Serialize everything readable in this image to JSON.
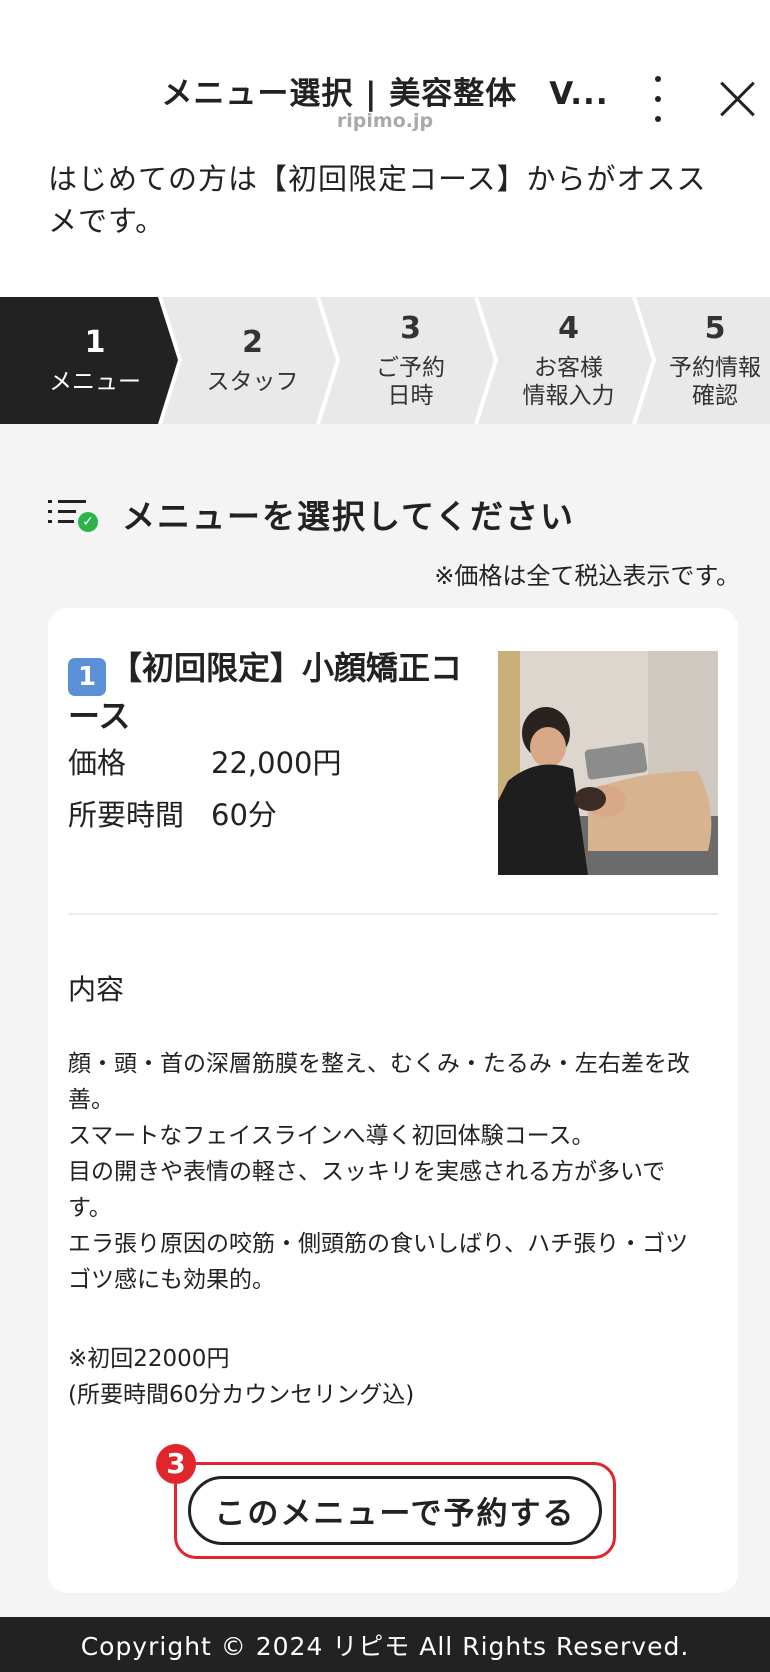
{
  "header": {
    "title": "メニュー選択 | 美容整体　V...",
    "domain": "ripimo.jp"
  },
  "intro": "はじめての方は【初回限定コース】からがオススメです。",
  "steps": [
    {
      "num": "1",
      "label": "メニュー",
      "active": true
    },
    {
      "num": "2",
      "label": "スタッフ",
      "active": false
    },
    {
      "num": "3",
      "label": "ご予約\n日時",
      "active": false
    },
    {
      "num": "4",
      "label": "お客様\n情報入力",
      "active": false
    },
    {
      "num": "5",
      "label": "予約情報\n確認",
      "active": false
    }
  ],
  "section": {
    "title": "メニューを選択してください",
    "price_note": "※価格は全て税込表示です。"
  },
  "course": {
    "badge": "1",
    "title": "【初回限定】小顔矯正コース",
    "price_label": "価格",
    "price_value": "22,000円",
    "duration_label": "所要時間",
    "duration_value": "60分",
    "content_heading": "内容",
    "description": "顔・頭・首の深層筋膜を整え、むくみ・たるみ・左右差を改善。\nスマートなフェイスラインへ導く初回体験コース。\n目の開きや表情の軽さ、スッキリを実感される方が多いです。\nエラ張り原因の咬筋・側頭筋の食いしばり、ハチ張り・ゴツゴツ感にも効果的。",
    "note_line1": "※初回22000円",
    "note_line2": "(所要時間60分カウンセリング込)",
    "cta": "このメニューで予約する"
  },
  "annotation": {
    "marker": "3",
    "color": "#e0252d"
  },
  "footer": "Copyright © 2024 リピモ All Rights Reserved.",
  "colors": {
    "active_step": "#222222",
    "inactive_step": "#e9e9e9",
    "check": "#2db34a",
    "badge": "#5b8fd6"
  }
}
